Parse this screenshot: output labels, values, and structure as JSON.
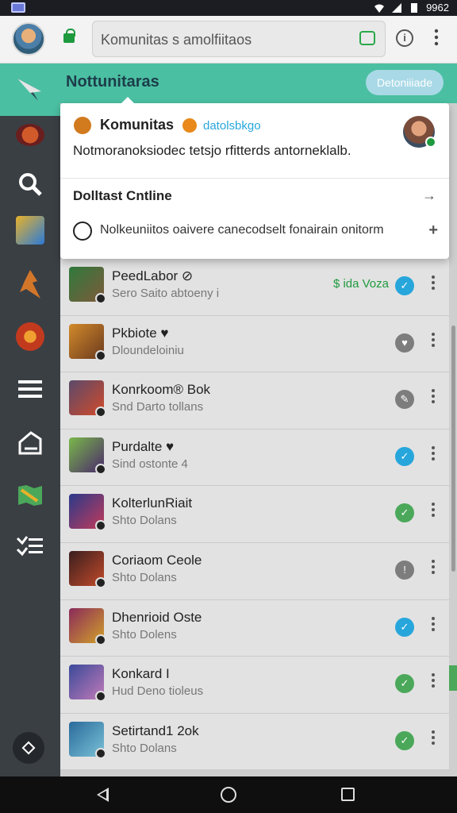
{
  "status_bar": {
    "time": "9962"
  },
  "app_bar": {
    "url": "Komunitas s amolfiitaos",
    "info_label": "i",
    "more_label": "⋮"
  },
  "header": {
    "title": "Nottunitaras",
    "button_label": "Detoniiiade"
  },
  "card": {
    "title": "Komunitas",
    "handle": "datolsbkgo",
    "description": "Notmoranoksiodec tetsjo rfitterds antorneklalb.",
    "section_title": "Dolltast Cntline",
    "note": "Nolkeuniitos oaivere canecodselt fonairain onitorm",
    "arrow": "→",
    "plus": "+"
  },
  "rail": {
    "items": [
      "game-crest",
      "search",
      "game-1",
      "game-2",
      "game-3",
      "menu",
      "edit",
      "map",
      "list"
    ],
    "fab": "navigate"
  },
  "list": [
    {
      "name": "PeedLabor ⊘",
      "sub": "Sero Saito abtoeny i",
      "tag": "$ ida Voza",
      "badge": "blue",
      "badge_glyph": "✓",
      "thumb": [
        "#2f7a3d",
        "#7d5a3a"
      ]
    },
    {
      "name": "Pkbiote ♥",
      "sub": "Dloundeloiniu",
      "tag": "",
      "badge": "grey",
      "badge_glyph": "♥",
      "thumb": [
        "#d28a2a",
        "#6b3a1e"
      ]
    },
    {
      "name": "Konrkoom® Bok",
      "sub": "Snd Darto tollans",
      "tag": "",
      "badge": "grey",
      "badge_glyph": "✎",
      "thumb": [
        "#5a4a6b",
        "#d24a2a"
      ]
    },
    {
      "name": "Purdalte ♥",
      "sub": "Sind ostonte 4",
      "tag": "",
      "badge": "blue",
      "badge_glyph": "✓",
      "thumb": [
        "#7ab84a",
        "#4a2a6b"
      ]
    },
    {
      "name": "KolterlunRiait",
      "sub": "Shto Dolans",
      "tag": "",
      "badge": "green",
      "badge_glyph": "✓",
      "thumb": [
        "#2a3a8a",
        "#c23a5a"
      ]
    },
    {
      "name": "Coriaom Ceole",
      "sub": "Shto Dolans",
      "tag": "",
      "badge": "grey",
      "badge_glyph": "!",
      "thumb": [
        "#3a1e1e",
        "#c24a2a"
      ]
    },
    {
      "name": "Dhenrioid Oste",
      "sub": "Shto Dolens",
      "tag": "",
      "badge": "blue",
      "badge_glyph": "✓",
      "thumb": [
        "#8a2a5a",
        "#d2a02a"
      ]
    },
    {
      "name": "Konkard I",
      "sub": "Hud Deno tioleus",
      "tag": "",
      "badge": "green",
      "badge_glyph": "✓",
      "thumb": [
        "#3a4a9a",
        "#c27ab8"
      ]
    },
    {
      "name": "Setirtand1 2ok",
      "sub": "Shto Dolans",
      "tag": "",
      "badge": "green",
      "badge_glyph": "✓",
      "thumb": [
        "#2a6a9a",
        "#7ac2d8"
      ]
    }
  ],
  "nav_bar": {
    "back": "back",
    "home": "home",
    "recents": "recents"
  }
}
